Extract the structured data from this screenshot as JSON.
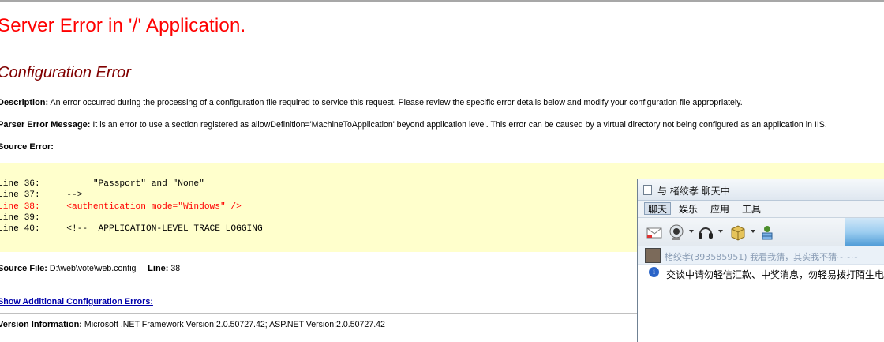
{
  "page": {
    "title": "Server Error in '/' Application.",
    "subtitle": "Configuration Error",
    "description_label": "Description:",
    "description_text": "An error occurred during the processing of a configuration file required to service this request. Please review the specific error details below and modify your configuration file appropriately.",
    "parser_label": "Parser Error Message:",
    "parser_text": "It is an error to use a section registered as allowDefinition='MachineToApplication' beyond application level.  This error can be caused by a virtual directory not being configured as an application in IIS.",
    "source_error_label": "Source Error:",
    "source_lines": [
      {
        "text": "Line 36:          \"Passport\" and \"None\"",
        "highlight": false
      },
      {
        "text": "Line 37:     -->",
        "highlight": false
      },
      {
        "text": "Line 38:     <authentication mode=\"Windows\" />",
        "highlight": true
      },
      {
        "text": "Line 39:",
        "highlight": false
      },
      {
        "text": "Line 40:     <!--  APPLICATION-LEVEL TRACE LOGGING",
        "highlight": false
      }
    ],
    "source_file_label": "Source File:",
    "source_file_value": "D:\\web\\vote\\web.config",
    "line_label": "Line:",
    "line_value": "38",
    "additional_errors_link": "Show Additional Configuration Errors:",
    "version_label": "Version Information:",
    "version_text": "Microsoft .NET Framework Version:2.0.50727.42; ASP.NET Version:2.0.50727.42"
  },
  "chat": {
    "window_title": "与 楮绞孝 聊天中",
    "menu": [
      "聊天",
      "娱乐",
      "应用",
      "工具"
    ],
    "active_menu": "聊天",
    "message_preview": "楮绞孝(393585951)  我看我猜，其实我不猜~~~",
    "notice": "交谈中请勿轻信汇款、中奖消息，勿轻易拨打陌生电"
  },
  "colors": {
    "title_red": "#ff0000",
    "subtitle_maroon": "#800000",
    "source_bg": "#ffffcc",
    "link_blue": "#0000aa"
  }
}
